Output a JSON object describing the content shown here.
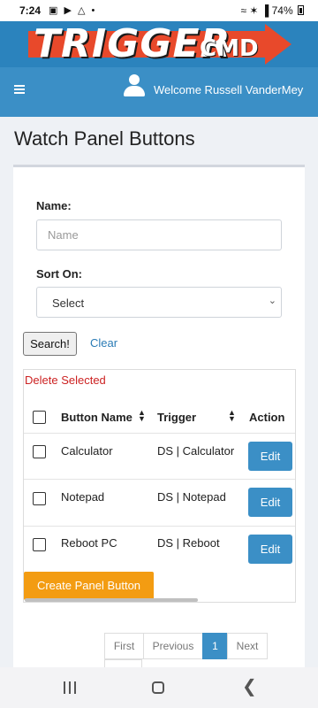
{
  "status_bar": {
    "time": "7:24",
    "notification_icons": "▣ ▶ △ •",
    "signal_icons": "≈ ✶ ▐",
    "battery_percent": "74%"
  },
  "logo": {
    "text_main": "TRIGGER",
    "text_sub": "CMD",
    "colors": {
      "banner": "#2b83bd",
      "arrow": "#e8492b"
    }
  },
  "navbar": {
    "menu_icon": "hamburger-icon",
    "user_icon": "user-icon",
    "welcome_text": "Welcome Russell VanderMey"
  },
  "page": {
    "title": "Watch Panel Buttons"
  },
  "filters": {
    "name_label": "Name:",
    "name_placeholder": "Name",
    "sort_label": "Sort On:",
    "sort_selected": "Select",
    "search_label": "Search!",
    "clear_label": "Clear"
  },
  "table": {
    "delete_selected_label": "Delete Selected",
    "columns": [
      "Button Name",
      "Trigger",
      "Action"
    ],
    "rows": [
      {
        "button_name": "Calculator",
        "trigger": "DS | Calculator",
        "action": "Edit"
      },
      {
        "button_name": "Notepad",
        "trigger": "DS | Notepad",
        "action": "Edit"
      },
      {
        "button_name": "Reboot PC",
        "trigger": "DS | Reboot",
        "action": "Edit"
      }
    ],
    "create_button_label": "Create Panel Button"
  },
  "pagination": {
    "first": "First",
    "previous": "Previous",
    "current_page": "1",
    "next": "Next"
  },
  "colors": {
    "primary": "#3b8fc6",
    "warning": "#f39c12",
    "danger": "#cc2222",
    "link": "#2a7bb5"
  }
}
